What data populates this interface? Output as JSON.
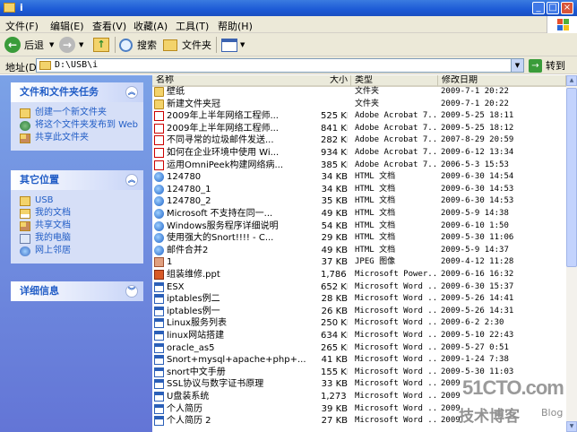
{
  "window": {
    "title": "i"
  },
  "menu": [
    "文件(F)",
    "编辑(E)",
    "查看(V)",
    "收藏(A)",
    "工具(T)",
    "帮助(H)"
  ],
  "toolbar": {
    "back": "后退",
    "search": "搜索",
    "folders": "文件夹"
  },
  "address": {
    "label": "地址(D)",
    "path": "D:\\USB\\i",
    "go": "转到"
  },
  "tasks_panel": {
    "title": "文件和文件夹任务",
    "items": [
      {
        "icon": "new-folder-icon",
        "label": "创建一个新文件夹"
      },
      {
        "icon": "publish-web-icon",
        "label": "将这个文件夹发布到 Web"
      },
      {
        "icon": "share-folder-icon",
        "label": "共享此文件夹"
      }
    ]
  },
  "places_panel": {
    "title": "其它位置",
    "items": [
      {
        "icon": "folder-icon",
        "label": "USB"
      },
      {
        "icon": "my-documents-icon",
        "label": "我的文档"
      },
      {
        "icon": "shared-documents-icon",
        "label": "共享文档"
      },
      {
        "icon": "my-computer-icon",
        "label": "我的电脑"
      },
      {
        "icon": "network-places-icon",
        "label": "网上邻居"
      }
    ]
  },
  "details_panel": {
    "title": "详细信息"
  },
  "columns": {
    "name": "名称",
    "size": "大小",
    "type": "类型",
    "modified": "修改日期"
  },
  "files": [
    {
      "icon": "folder",
      "name": "壁纸",
      "size": "",
      "type": "文件夹",
      "date": "2009-7-1 20:22"
    },
    {
      "icon": "folder",
      "name": "新建文件夹冠",
      "size": "",
      "type": "文件夹",
      "date": "2009-7-1 20:22"
    },
    {
      "icon": "pdf",
      "name": "2009年上半年网络工程师...",
      "size": "525 KB",
      "type": "Adobe Acrobat 7...",
      "date": "2009-5-25 18:11"
    },
    {
      "icon": "pdf",
      "name": "2009年上半年网络工程师...",
      "size": "841 KB",
      "type": "Adobe Acrobat 7...",
      "date": "2009-5-25 18:12"
    },
    {
      "icon": "pdf",
      "name": "不同寻常的垃圾邮件发送...",
      "size": "282 KB",
      "type": "Adobe Acrobat 7...",
      "date": "2007-8-29 20:59"
    },
    {
      "icon": "pdf",
      "name": "如何在企业环境中使用 Wi...",
      "size": "934 KB",
      "type": "Adobe Acrobat 7...",
      "date": "2009-6-12 13:34"
    },
    {
      "icon": "pdf",
      "name": "运用OmniPeek构建网络病...",
      "size": "385 KB",
      "type": "Adobe Acrobat 7...",
      "date": "2006-5-3 15:53"
    },
    {
      "icon": "html",
      "name": "124780",
      "size": "34 KB",
      "type": "HTML 文档",
      "date": "2009-6-30 14:54"
    },
    {
      "icon": "html",
      "name": "124780_1",
      "size": "34 KB",
      "type": "HTML 文档",
      "date": "2009-6-30 14:53"
    },
    {
      "icon": "html",
      "name": "124780_2",
      "size": "35 KB",
      "type": "HTML 文档",
      "date": "2009-6-30 14:53"
    },
    {
      "icon": "html",
      "name": "Microsoft 不支持在同一...",
      "size": "49 KB",
      "type": "HTML 文档",
      "date": "2009-5-9 14:38"
    },
    {
      "icon": "html",
      "name": "Windows服务程序详细说明",
      "size": "54 KB",
      "type": "HTML 文档",
      "date": "2009-6-10 1:50"
    },
    {
      "icon": "html",
      "name": "使用强大的Snort!!!! - C...",
      "size": "29 KB",
      "type": "HTML 文档",
      "date": "2009-5-30 11:06"
    },
    {
      "icon": "html",
      "name": "邮件合并2",
      "size": "49 KB",
      "type": "HTML 文档",
      "date": "2009-5-9 14:37"
    },
    {
      "icon": "jpg",
      "name": "1",
      "size": "37 KB",
      "type": "JPEG 图像",
      "date": "2009-4-12 11:28"
    },
    {
      "icon": "ppt",
      "name": "组装维修.ppt",
      "size": "1,786 KB",
      "type": "Microsoft Power...",
      "date": "2009-6-16 16:32"
    },
    {
      "icon": "doc",
      "name": "ESX",
      "size": "652 KB",
      "type": "Microsoft Word ...",
      "date": "2009-6-30 15:37"
    },
    {
      "icon": "doc",
      "name": "iptables例二",
      "size": "28 KB",
      "type": "Microsoft Word ...",
      "date": "2009-5-26 14:41"
    },
    {
      "icon": "doc",
      "name": "iptables例一",
      "size": "26 KB",
      "type": "Microsoft Word ...",
      "date": "2009-5-26 14:31"
    },
    {
      "icon": "doc",
      "name": "Linux服务列表",
      "size": "250 KB",
      "type": "Microsoft Word ...",
      "date": "2009-6-2 2:30"
    },
    {
      "icon": "doc",
      "name": "linux网站搭建",
      "size": "634 KB",
      "type": "Microsoft Word ...",
      "date": "2009-5-10 22:43"
    },
    {
      "icon": "doc",
      "name": "oracle_as5",
      "size": "265 KB",
      "type": "Microsoft Word ...",
      "date": "2009-5-27 0:51"
    },
    {
      "icon": "doc",
      "name": "Snort+mysql+apache+php+...",
      "size": "41 KB",
      "type": "Microsoft Word ...",
      "date": "2009-1-24 7:38"
    },
    {
      "icon": "doc",
      "name": "snort中文手册",
      "size": "155 KB",
      "type": "Microsoft Word ...",
      "date": "2009-5-30 11:03"
    },
    {
      "icon": "doc",
      "name": "SSL协议与数字证书原理",
      "size": "33 KB",
      "type": "Microsoft Word ...",
      "date": "2009"
    },
    {
      "icon": "doc",
      "name": "U盘装系统",
      "size": "1,273 KB",
      "type": "Microsoft Word ...",
      "date": "2009"
    },
    {
      "icon": "doc",
      "name": "个人简历",
      "size": "39 KB",
      "type": "Microsoft Word ...",
      "date": "2009"
    },
    {
      "icon": "doc",
      "name": "个人简历 2",
      "size": "27 KB",
      "type": "Microsoft Word ...",
      "date": "2009"
    }
  ],
  "watermark": {
    "line1": "51CTO.com",
    "line2": "技术博客",
    "line3": "Blog"
  }
}
